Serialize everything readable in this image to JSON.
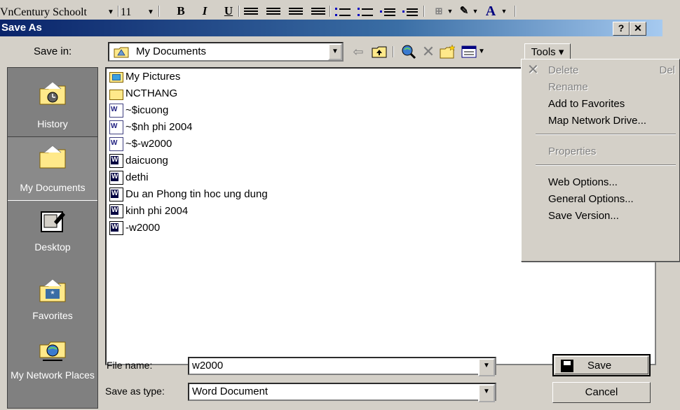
{
  "background_toolbar": {
    "font_name": "VnCentury Schoolt",
    "font_size": "11",
    "bold": "B",
    "italic": "I",
    "underline": "U",
    "font_color": "A"
  },
  "dialog": {
    "title": "Save As",
    "help_button": "?",
    "close_button": "✕"
  },
  "save_in": {
    "label": "Save in:",
    "value": "My Documents"
  },
  "toolbar": {
    "back_icon": "back-arrow-icon",
    "up_icon": "up-folder-icon",
    "search_web_icon": "search-web-icon",
    "delete_icon": "delete-icon",
    "new_folder_icon": "new-folder-icon",
    "views_icon": "views-icon",
    "tools_label": "Tools ▾"
  },
  "places": [
    {
      "label": "History"
    },
    {
      "label": "My Documents"
    },
    {
      "label": "Desktop"
    },
    {
      "label": "Favorites"
    },
    {
      "label": "My Network Places"
    }
  ],
  "files": [
    {
      "name": "My Pictures",
      "type": "pictures-folder"
    },
    {
      "name": "NCTHANG",
      "type": "folder"
    },
    {
      "name": "~$icuong",
      "type": "doc-temp"
    },
    {
      "name": "~$nh phi 2004",
      "type": "doc-temp"
    },
    {
      "name": "~$-w2000",
      "type": "doc-temp"
    },
    {
      "name": "daicuong",
      "type": "doc"
    },
    {
      "name": "dethi",
      "type": "doc"
    },
    {
      "name": "Du an Phong tin hoc ung dung",
      "type": "doc"
    },
    {
      "name": "kinh phi 2004",
      "type": "doc"
    },
    {
      "name": "-w2000",
      "type": "doc"
    }
  ],
  "file_name": {
    "label": "File name:",
    "value": "w2000"
  },
  "save_as_type": {
    "label": "Save as type:",
    "value": "Word Document"
  },
  "buttons": {
    "save": "Save",
    "cancel": "Cancel"
  },
  "tools_menu": {
    "items": [
      {
        "label": "Delete",
        "shortcut": "Del",
        "disabled": true
      },
      {
        "label": "Rename",
        "disabled": true
      },
      {
        "label": "Add to Favorites",
        "disabled": false
      },
      {
        "label": "Map Network Drive...",
        "disabled": false
      },
      {
        "label": "Properties",
        "disabled": true
      },
      {
        "label": "Web Options...",
        "disabled": false
      },
      {
        "label": "General Options...",
        "disabled": false
      },
      {
        "label": "Save Version...",
        "disabled": false
      }
    ]
  },
  "colors": {
    "title_bar": "#0a246a",
    "face": "#d4d0c8",
    "places_bar": "#808080"
  }
}
